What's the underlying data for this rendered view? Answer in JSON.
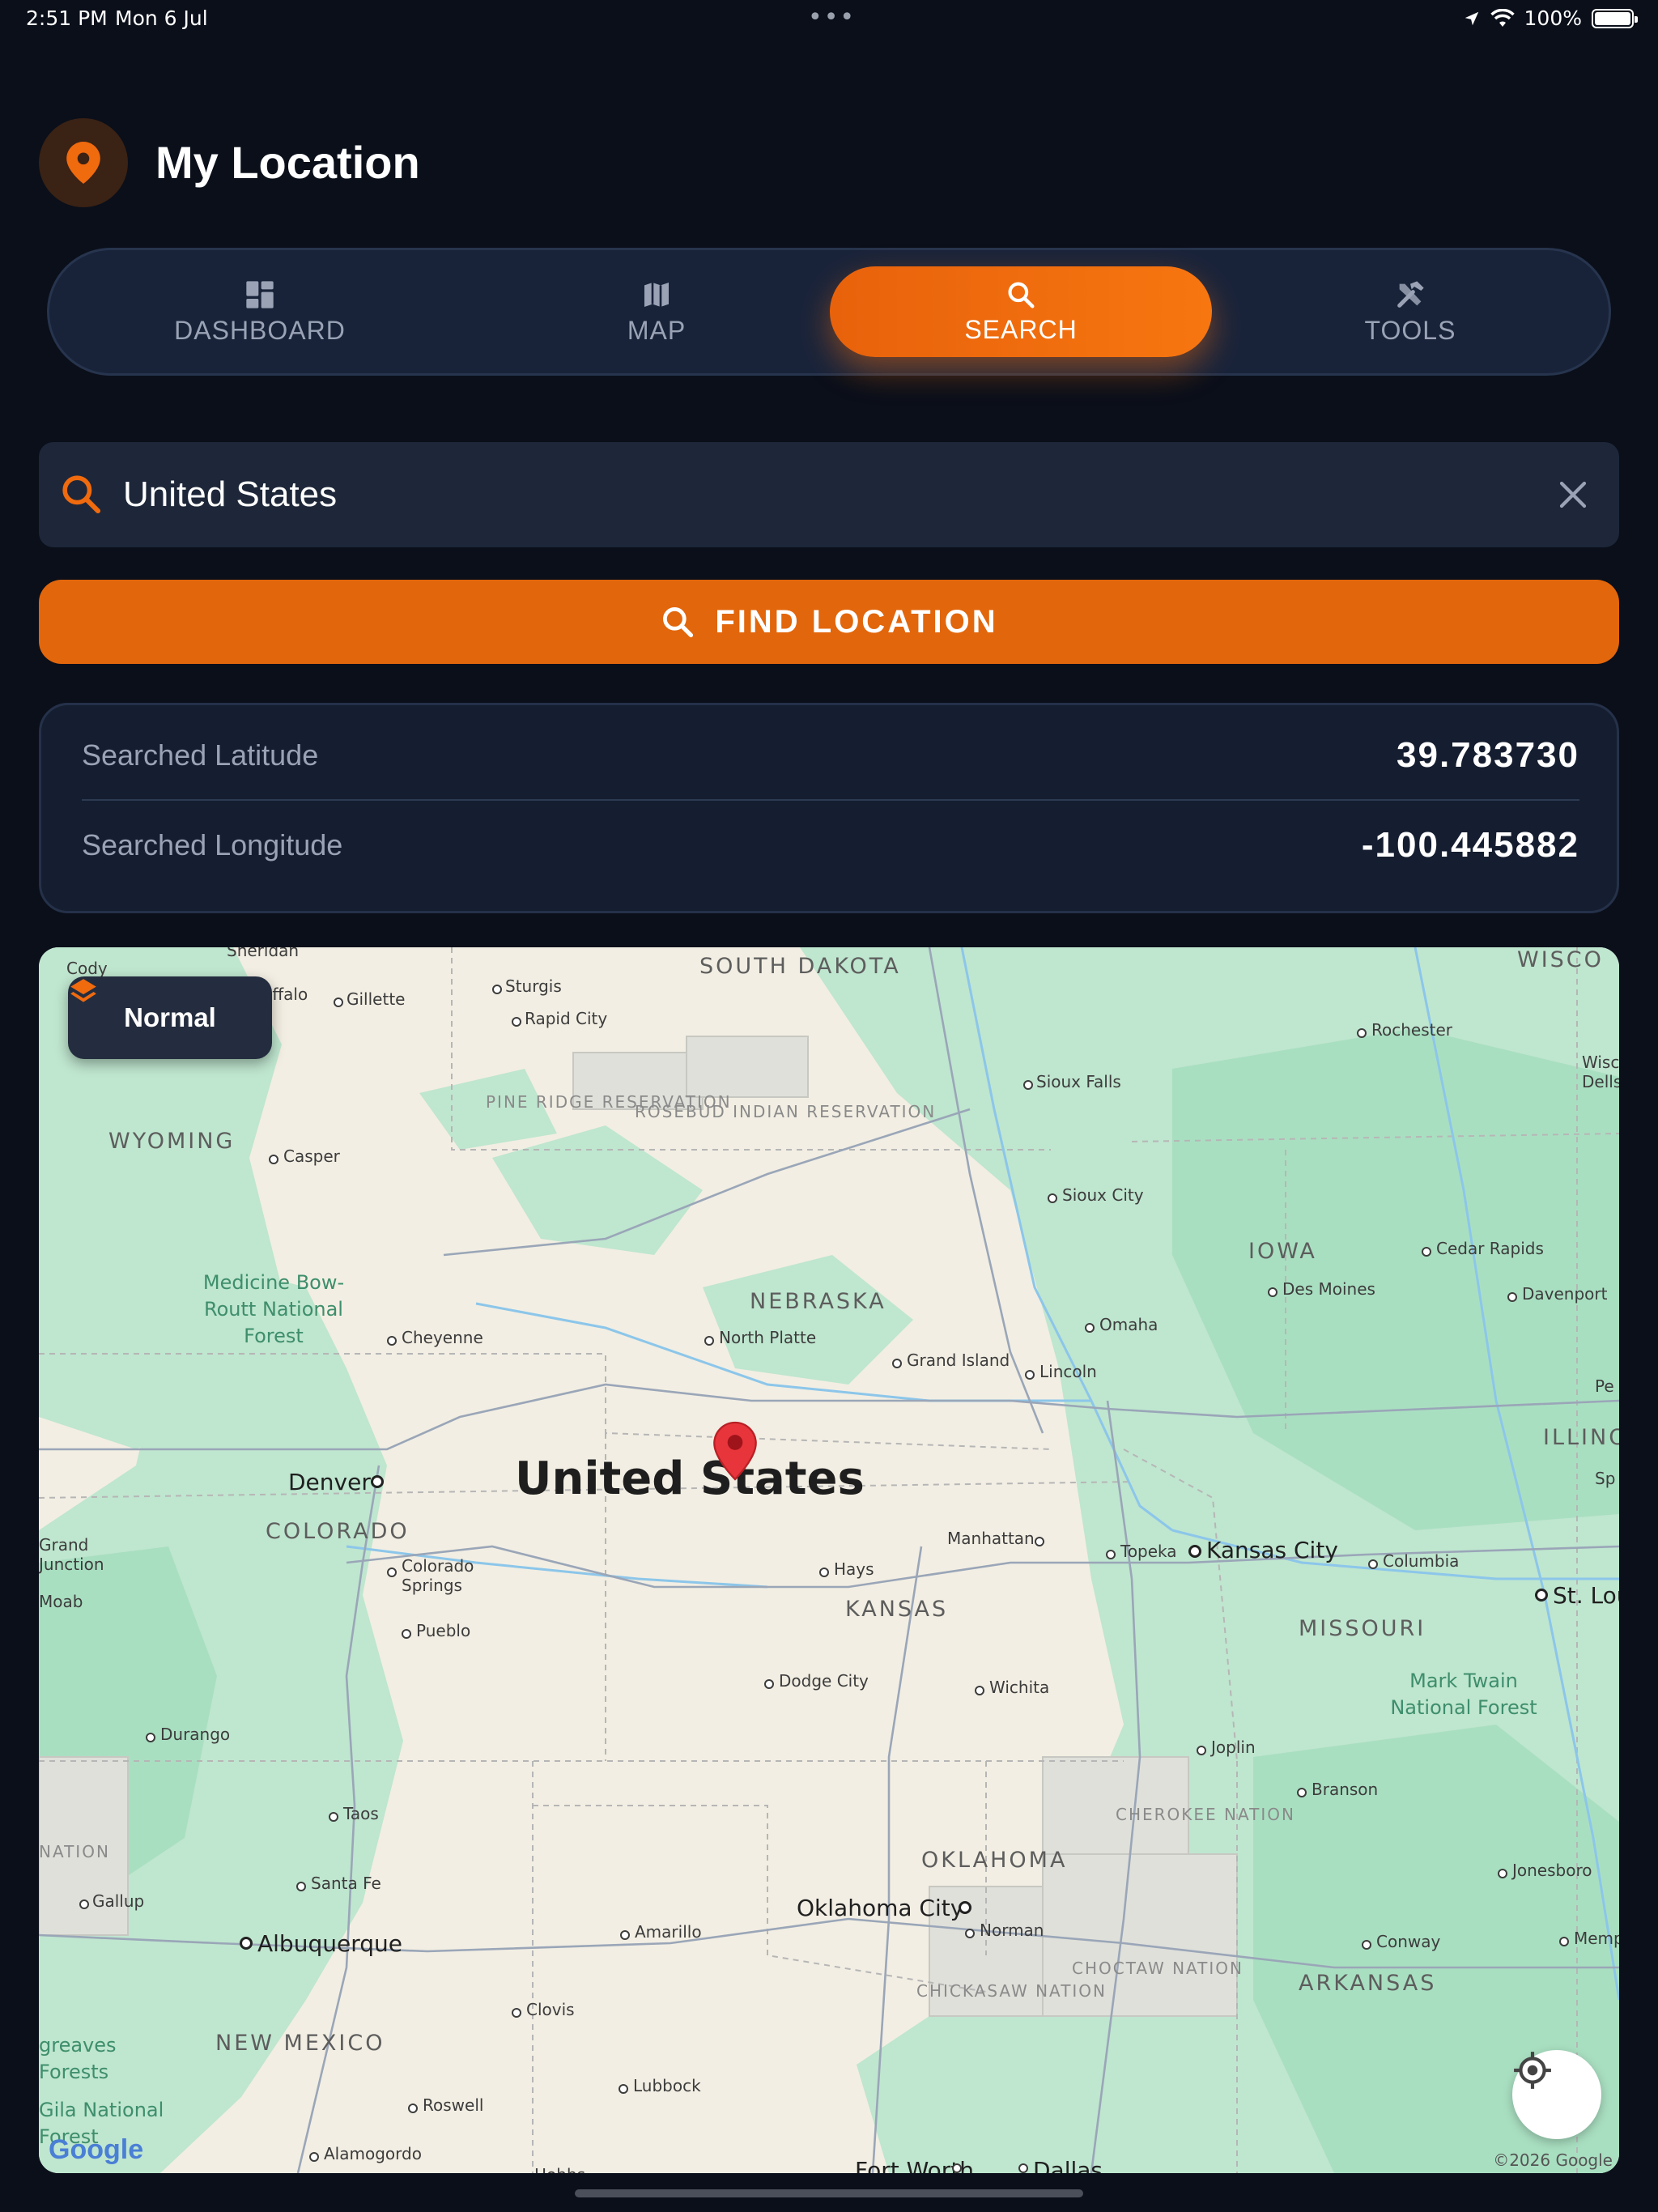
{
  "status_bar": {
    "time": "2:51 PM",
    "date": "Mon 6 Jul",
    "battery": "100%"
  },
  "header": {
    "title": "My Location",
    "icon": "location-pin-icon"
  },
  "tabs": [
    {
      "label": "DASHBOARD",
      "icon": "grid-icon",
      "active": false
    },
    {
      "label": "MAP",
      "icon": "map-icon",
      "active": false
    },
    {
      "label": "SEARCH",
      "icon": "search-icon",
      "active": true
    },
    {
      "label": "TOOLS",
      "icon": "tools-icon",
      "active": false
    }
  ],
  "search": {
    "value": "United States",
    "button_label": "FIND LOCATION"
  },
  "coordinates": {
    "latitude_label": "Searched Latitude",
    "latitude_value": "39.783730",
    "longitude_label": "Searched Longitude",
    "longitude_value": "-100.445882"
  },
  "map": {
    "type_label": "Normal",
    "country_label": "United States",
    "copyright": "©2026 Google",
    "logo": "Google",
    "labels": {
      "south_dakota": "SOUTH DAKOTA",
      "wyoming": "WYOMING",
      "nebraska": "NEBRASKA",
      "iowa": "IOWA",
      "colorado": "COLORADO",
      "kansas": "KANSAS",
      "missouri": "MISSOURI",
      "oklahoma": "OKLAHOMA",
      "arkansas": "ARKANSAS",
      "new_mexico": "NEW MEXICO",
      "illinois": "ILLINO",
      "wisconsin": "WISCO",
      "pine_ridge": "PINE RIDGE RESERVATION",
      "rosebud": "ROSEBUD INDIAN RESERVATION",
      "cherokee": "CHEROKEE NATION",
      "choctaw": "CHOCTAW NATION",
      "chickasaw": "CHICKASAW NATION",
      "nation": "NATION",
      "medicine_bow": "Medicine Bow-Routt National Forest",
      "mark_twain": "Mark Twain National Forest",
      "gila": "Gila National Forest",
      "greaves": "greaves Forests",
      "cody": "Cody",
      "sheridan": "Sheridan",
      "buffalo": "Buffalo",
      "gillette": "Gillette",
      "sturgis": "Sturgis",
      "rapid_city": "Rapid City",
      "rochester": "Rochester",
      "sioux_falls": "Sioux Falls",
      "casper": "Casper",
      "sioux_city": "Sioux City",
      "cedar_rapids": "Cedar Rapids",
      "des_moines": "Des Moines",
      "davenport": "Davenport",
      "omaha": "Omaha",
      "cheyenne": "Cheyenne",
      "north_platte": "North Platte",
      "grand_island": "Grand Island",
      "lincoln": "Lincoln",
      "denver": "Denver",
      "grand_junction": "Grand Junction",
      "moab": "Moab",
      "colorado_springs": "Colorado Springs",
      "pueblo": "Pueblo",
      "hays": "Hays",
      "manhattan": "Manhattan",
      "topeka": "Topeka",
      "kansas_city": "Kansas City",
      "columbia": "Columbia",
      "st_louis": "St. Lou",
      "dodge_city": "Dodge City",
      "wichita": "Wichita",
      "durango": "Durango",
      "joplin": "Joplin",
      "branson": "Branson",
      "taos": "Taos",
      "santa_fe": "Santa Fe",
      "gallup": "Gallup",
      "jonesboro": "Jonesboro",
      "oklahoma_city": "Oklahoma City",
      "norman": "Norman",
      "amarillo": "Amarillo",
      "conway": "Conway",
      "memphis": "Memph",
      "albuquerque": "Albuquerque",
      "clovis": "Clovis",
      "lubbock": "Lubbock",
      "roswell": "Roswell",
      "alamogordo": "Alamogordo",
      "fort_worth": "Fort Worth",
      "dallas": "Dallas",
      "hobbs": "Hobbs",
      "peoria": "Pe",
      "springfield": "Sp",
      "wisconsin_dells": "Wisc Dells"
    }
  },
  "colors": {
    "accent": "#F06A0E",
    "background": "#0A0F1A",
    "card": "#151E30"
  }
}
